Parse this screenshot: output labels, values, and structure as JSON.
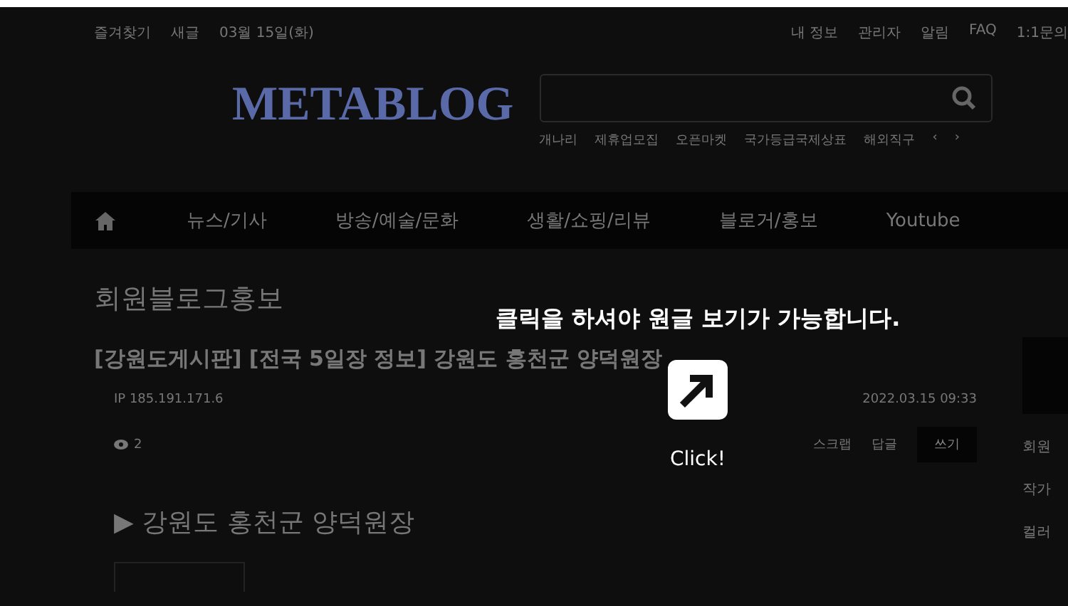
{
  "top_bar": {
    "left_links": [
      "즐겨찾기",
      "새글",
      "03월 15일(화)"
    ],
    "right_links": [
      "내 정보",
      "관리자",
      "알림",
      "FAQ",
      "1:1문의"
    ]
  },
  "header": {
    "logo": "METABLOG",
    "tags": [
      "개나리",
      "제휴업모집",
      "오픈마켓",
      "국가등급국제상표",
      "해외직구"
    ],
    "prev": "‹",
    "next": "›"
  },
  "nav": {
    "items": [
      "뉴스/기사",
      "방송/예술/문화",
      "생활/쇼핑/리뷰",
      "블로거/홍보",
      "Youtube"
    ]
  },
  "post": {
    "category": "회원블로그홍보",
    "title": "[강원도게시판] [전국 5일장 정보] 강원도 홍천군 양덕원장",
    "author": "IP 185.191.171.6",
    "date": "2022.03.15 09:33",
    "views": "2",
    "actions": [
      "스크랩",
      "답글"
    ],
    "write": "쓰기",
    "heading": "▶ 강원도 홍천군 양덕원장"
  },
  "sidebar": {
    "items": [
      "회원",
      "작가",
      "컬러"
    ]
  },
  "overlay": {
    "message": "클릭을 하셔야 원글 보기가 가능합니다.",
    "button": "Click!"
  }
}
